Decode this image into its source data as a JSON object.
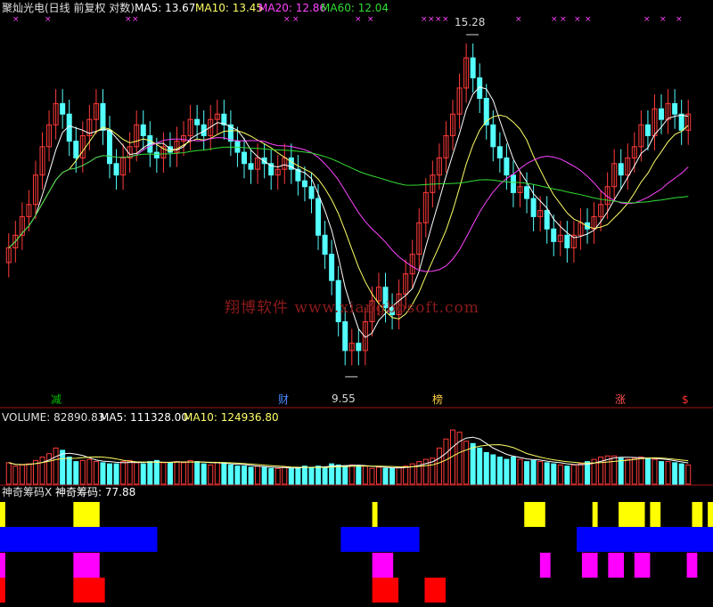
{
  "header": {
    "stock": "聚灿光电(日线 前复权 对数)",
    "ma5_label": "MA5: 13.67",
    "ma10_label": "MA10: 13.45",
    "ma20_label": "MA20: 12.86",
    "ma60_label": "MA60: 12.04"
  },
  "price_panel": {
    "high_label": "15.28",
    "low_label": "9.55",
    "watermark": "翔博软件 www.xiangbosoft.com",
    "markers": [
      {
        "text": "减",
        "color": "#00c000"
      },
      {
        "text": "财",
        "color": "#4a8cff"
      },
      {
        "text": "榜",
        "color": "#ffd040"
      },
      {
        "text": "涨",
        "color": "#ff5050"
      },
      {
        "text": "$",
        "color": "#ff3030"
      }
    ]
  },
  "volume_panel": {
    "volume_label": "VOLUME: 82890.83",
    "ma5_label": "MA5: 111328.00",
    "ma10_label": "MA10: 124936.80"
  },
  "chip_panel": {
    "title": "神奇筹码X",
    "value_label": "神奇筹码: 77.88"
  },
  "colors": {
    "up": "#ff3b3b",
    "down": "#54ffff",
    "ma5": "#ffffff",
    "ma10": "#ffff66",
    "ma20": "#ff44ff",
    "ma60": "#33dd33",
    "yellow": "#ffff00",
    "blue": "#0000ff",
    "magenta": "#ff00ff",
    "red": "#ff0000"
  },
  "chart_data": [
    {
      "type": "candlestick",
      "title": "聚灿光电(日线 前复权 对数)",
      "scale": "log",
      "ylim": [
        9.3,
        15.6
      ],
      "annotations": [
        {
          "text": "15.28",
          "value": 15.28
        },
        {
          "text": "9.55",
          "value": 9.55
        }
      ],
      "closes": [
        11.4,
        11.6,
        11.9,
        12.1,
        12.6,
        13.1,
        13.5,
        13.9,
        13.7,
        13.2,
        12.9,
        13.3,
        13.6,
        13.9,
        13.4,
        12.8,
        12.6,
        12.9,
        13.1,
        13.5,
        13.3,
        13.0,
        12.9,
        13.1,
        13.0,
        13.2,
        13.3,
        13.6,
        13.5,
        13.3,
        13.6,
        13.7,
        13.5,
        13.2,
        13.0,
        12.8,
        12.7,
        12.9,
        12.8,
        12.6,
        12.7,
        12.9,
        12.7,
        12.5,
        12.4,
        12.2,
        11.6,
        11.3,
        10.9,
        10.3,
        9.9,
        10.0,
        9.9,
        10.3,
        10.6,
        10.8,
        10.5,
        10.4,
        10.7,
        11.0,
        11.3,
        11.8,
        12.3,
        12.6,
        12.9,
        13.3,
        13.7,
        14.2,
        14.8,
        14.4,
        14.0,
        13.5,
        13.1,
        12.9,
        12.6,
        12.3,
        12.4,
        12.2,
        11.9,
        12.0,
        11.7,
        11.5,
        11.6,
        11.4,
        11.6,
        11.8,
        11.7,
        11.9,
        12.1,
        12.4,
        12.8,
        12.6,
        12.9,
        13.1,
        13.5,
        13.3,
        13.8,
        13.6,
        13.9,
        13.7,
        13.4,
        13.7
      ],
      "volumes": [
        95,
        80,
        85,
        90,
        105,
        120,
        135,
        160,
        150,
        120,
        100,
        105,
        110,
        100,
        95,
        90,
        90,
        100,
        105,
        95,
        90,
        100,
        105,
        95,
        95,
        100,
        95,
        105,
        100,
        90,
        85,
        95,
        95,
        85,
        80,
        80,
        75,
        80,
        75,
        70,
        70,
        75,
        70,
        75,
        80,
        75,
        80,
        75,
        90,
        85,
        80,
        85,
        80,
        80,
        70,
        75,
        70,
        70,
        75,
        80,
        90,
        100,
        110,
        115,
        160,
        200,
        240,
        230,
        190,
        180,
        160,
        140,
        130,
        120,
        110,
        120,
        110,
        100,
        105,
        100,
        95,
        90,
        85,
        80,
        85,
        90,
        100,
        110,
        120,
        125,
        125,
        115,
        110,
        115,
        120,
        115,
        110,
        100,
        100,
        95,
        90,
        85
      ],
      "series": [
        {
          "name": "MA5",
          "value": 13.67
        },
        {
          "name": "MA10",
          "value": 13.45
        },
        {
          "name": "MA20",
          "value": 12.86
        },
        {
          "name": "MA60",
          "value": 12.04
        }
      ]
    },
    {
      "type": "bar",
      "title": "VOLUME: 82890.83",
      "series": [
        {
          "name": "VOLUME",
          "value": 82890.83
        },
        {
          "name": "MA5",
          "value": 111328.0
        },
        {
          "name": "MA10",
          "value": 124936.8
        }
      ]
    },
    {
      "type": "heatmap",
      "title": "神奇筹码X",
      "value": 77.88,
      "rows": [
        {
          "color": "yellow",
          "segments": [
            [
              0,
              1
            ],
            [
              14,
              19
            ],
            [
              71,
              72
            ],
            [
              100,
              104
            ],
            [
              113,
              114
            ],
            [
              118,
              123
            ],
            [
              124,
              126
            ],
            [
              132,
              134
            ],
            [
              135,
              136
            ]
          ]
        },
        {
          "color": "blue",
          "segments": [
            [
              0,
              30
            ],
            [
              65,
              80
            ],
            [
              110,
              136
            ]
          ]
        },
        {
          "color": "magenta",
          "segments": [
            [
              0,
              1
            ],
            [
              14,
              19
            ],
            [
              71,
              75
            ],
            [
              103,
              105
            ],
            [
              111,
              114
            ],
            [
              116,
              119
            ],
            [
              121,
              124
            ],
            [
              131,
              133
            ]
          ]
        },
        {
          "color": "red",
          "segments": [
            [
              0,
              1
            ],
            [
              14,
              20
            ],
            [
              71,
              76
            ],
            [
              81,
              85
            ]
          ]
        }
      ]
    }
  ]
}
